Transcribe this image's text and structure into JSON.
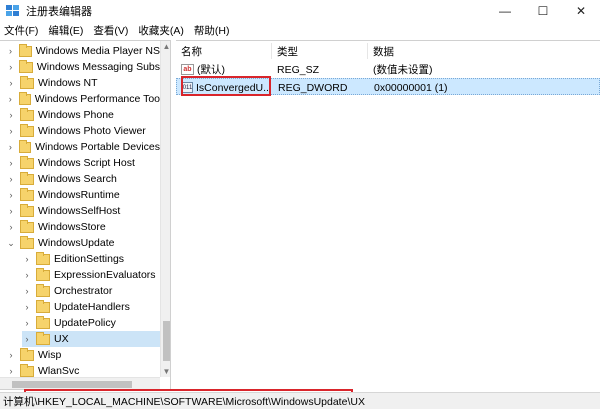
{
  "window": {
    "title": "注册表编辑器",
    "minimize": "—",
    "maximize": "☐",
    "close": "✕"
  },
  "menu": [
    "文件(F)",
    "编辑(E)",
    "查看(V)",
    "收藏夹(A)",
    "帮助(H)"
  ],
  "tree": {
    "items": [
      {
        "label": "Windows Media Player NS",
        "level": 0,
        "expanded": false
      },
      {
        "label": "Windows Messaging Subs",
        "level": 0,
        "expanded": false
      },
      {
        "label": "Windows NT",
        "level": 0,
        "expanded": false
      },
      {
        "label": "Windows Performance Too",
        "level": 0,
        "expanded": false
      },
      {
        "label": "Windows Phone",
        "level": 0,
        "expanded": false
      },
      {
        "label": "Windows Photo Viewer",
        "level": 0,
        "expanded": false
      },
      {
        "label": "Windows Portable Devices",
        "level": 0,
        "expanded": false
      },
      {
        "label": "Windows Script Host",
        "level": 0,
        "expanded": false
      },
      {
        "label": "Windows Search",
        "level": 0,
        "expanded": false
      },
      {
        "label": "WindowsRuntime",
        "level": 0,
        "expanded": false
      },
      {
        "label": "WindowsSelfHost",
        "level": 0,
        "expanded": false
      },
      {
        "label": "WindowsStore",
        "level": 0,
        "expanded": false
      },
      {
        "label": "WindowsUpdate",
        "level": 0,
        "expanded": true
      },
      {
        "label": "EditionSettings",
        "level": 1,
        "expanded": false
      },
      {
        "label": "ExpressionEvaluators",
        "level": 1,
        "expanded": false
      },
      {
        "label": "Orchestrator",
        "level": 1,
        "expanded": false
      },
      {
        "label": "UpdateHandlers",
        "level": 1,
        "expanded": false
      },
      {
        "label": "UpdatePolicy",
        "level": 1,
        "expanded": false
      },
      {
        "label": "UX",
        "level": 1,
        "expanded": false,
        "selected": true
      },
      {
        "label": "Wisp",
        "level": 0,
        "expanded": false
      },
      {
        "label": "WlanSvc",
        "level": 0,
        "expanded": false
      }
    ]
  },
  "list": {
    "columns": [
      "名称",
      "类型",
      "数据"
    ],
    "rows": [
      {
        "icon": "ab",
        "name": "(默认)",
        "type": "REG_SZ",
        "data": "(数值未设置)"
      },
      {
        "icon": "011",
        "name": "IsConvergedU...",
        "type": "REG_DWORD",
        "data": "0x00000001 (1)"
      }
    ]
  },
  "status": {
    "path": "计算机\\HKEY_LOCAL_MACHINE\\SOFTWARE\\Microsoft\\WindowsUpdate\\UX"
  },
  "colors": {
    "highlight": "#d9252b",
    "selection": "#cce8ff"
  }
}
